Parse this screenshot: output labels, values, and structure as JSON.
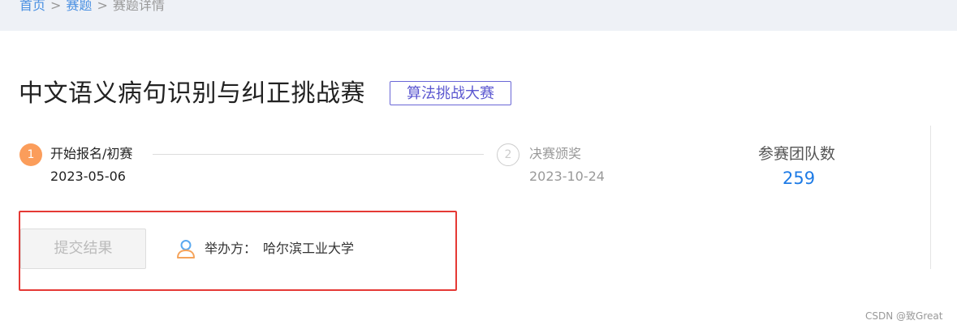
{
  "breadcrumb": {
    "home": "首页",
    "separator": ">",
    "problems": "赛题",
    "current": "赛题详情"
  },
  "competition": {
    "title": "中文语义病句识别与纠正挑战赛",
    "tag": "算法挑战大赛"
  },
  "steps": [
    {
      "number": "1",
      "label": "开始报名/初赛",
      "date": "2023-05-06",
      "status": "active"
    },
    {
      "number": "2",
      "label": "决赛颁奖",
      "date": "2023-10-24",
      "status": "pending"
    }
  ],
  "teams": {
    "label": "参赛团队数",
    "count": "259"
  },
  "actions": {
    "submit_label": "提交结果"
  },
  "organizer": {
    "label": "举办方：",
    "name": "哈尔滨工业大学",
    "icon": "user-icon"
  },
  "watermark": "CSDN @致Great",
  "colors": {
    "accent_step": "#fb9d5b",
    "tag_border": "#6a67d6",
    "teams_count": "#1e7be6",
    "highlight_border": "#e53935",
    "breadcrumb_link": "#4a90e2"
  }
}
